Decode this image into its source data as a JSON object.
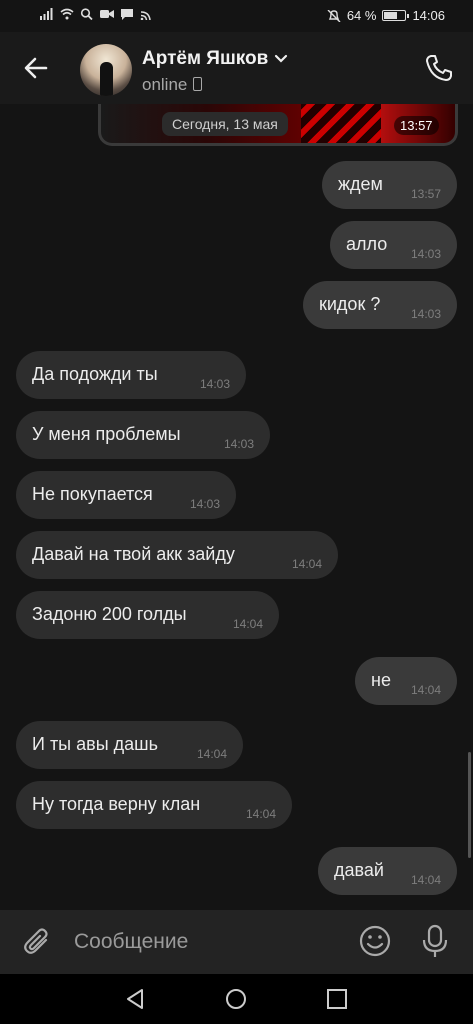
{
  "status_bar": {
    "battery_percent": "64 %",
    "battery_level": 0.64,
    "time": "14:06"
  },
  "header": {
    "contact_name": "Артём Яшков",
    "presence": "online"
  },
  "media": {
    "time": "13:57",
    "date_pill": "Сегодня, 13 мая"
  },
  "messages": [
    {
      "text": "ждем",
      "time": "13:57",
      "direction": "out"
    },
    {
      "text": "алло",
      "time": "14:03",
      "direction": "out"
    },
    {
      "text": "кидок ?",
      "time": "14:03",
      "direction": "out"
    },
    {
      "text": "Да подожди ты",
      "time": "14:03",
      "direction": "in"
    },
    {
      "text": "У меня проблемы",
      "time": "14:03",
      "direction": "in"
    },
    {
      "text": "Не покупается",
      "time": "14:03",
      "direction": "in"
    },
    {
      "text": "Давай на твой акк зайду",
      "time": "14:04",
      "direction": "in"
    },
    {
      "text": "Задоню 200 голды",
      "time": "14:04",
      "direction": "in"
    },
    {
      "text": "не",
      "time": "14:04",
      "direction": "out"
    },
    {
      "text": "И ты авы дашь",
      "time": "14:04",
      "direction": "in"
    },
    {
      "text": "Ну тогда верну клан",
      "time": "14:04",
      "direction": "in"
    },
    {
      "text": "давай",
      "time": "14:04",
      "direction": "out"
    }
  ],
  "composer": {
    "placeholder": "Сообщение"
  },
  "icons": {
    "back": "arrow-left-icon",
    "call": "phone-icon",
    "attach": "paperclip-icon",
    "emoji": "smiley-icon",
    "mic": "microphone-icon"
  },
  "colors": {
    "background": "#141414",
    "bubble_in": "#2d2d2d",
    "bubble_out": "#3a3a3a"
  }
}
